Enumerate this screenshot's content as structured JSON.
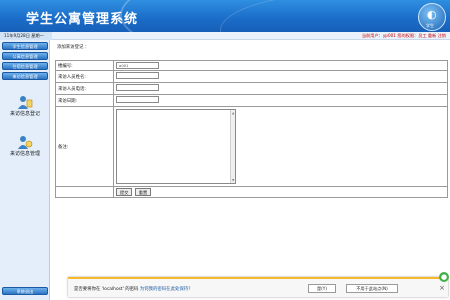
{
  "header": {
    "title": "学生公寓管理系统",
    "logo_text": "学生",
    "logo_symbol": "◐"
  },
  "infobar": {
    "date": "11年9月28日 星期一",
    "current_user": "当前用户：yp001 您的权限：员工 重新 注销"
  },
  "sidebar": {
    "menu": [
      "学生信息管理",
      "公寓信息管理",
      "住宿信息管理",
      "来访信息管理"
    ],
    "quick_links": [
      {
        "label": "来访信息登记",
        "icon": "register-icon"
      },
      {
        "label": "来访信息管理",
        "icon": "manage-icon"
      }
    ],
    "bottom_button": "系统退出"
  },
  "main": {
    "breadcrumb": "添加来访登记  ：",
    "fields": [
      {
        "label": "楼编号:",
        "value": "a001"
      },
      {
        "label": "来访人员姓名:",
        "value": ""
      },
      {
        "label": "来访人员电话:",
        "value": ""
      },
      {
        "label": "来访日期:",
        "value": ""
      }
    ],
    "remark_label": "备注:",
    "remark_value": "",
    "submit_label": "提交",
    "reset_label": "重置"
  },
  "notification": {
    "message_prefix": "是否要将你在 'localhost' 的密码",
    "message_suffix": " 为何我的密码在此处保持?",
    "yes_label": "是(Y)",
    "no_label": "不用于此站点(N)",
    "close_symbol": "×"
  },
  "colors": {
    "header": "#1a6cc8",
    "user_text": "#cc0000",
    "sidebar": "#e3eefa",
    "notif_border": "#f5b92a"
  }
}
